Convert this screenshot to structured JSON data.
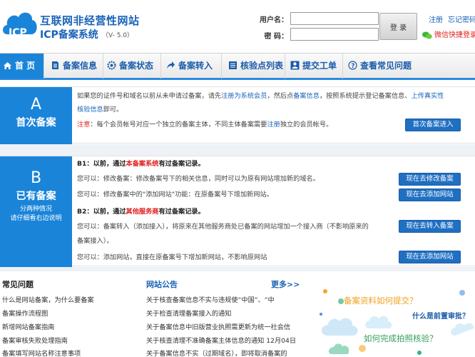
{
  "header": {
    "logo_text": "ICP",
    "title_line1": "互联网非经营性网站",
    "title_line2": "ICP备案系统",
    "version": "（V- 5.0）",
    "username_label": "用户名：",
    "password_label": "密  码：",
    "login_button": "登 录",
    "register_link": "注册",
    "forgot_link": "忘记密码",
    "wechat_text": "微信快捷登录"
  },
  "nav": {
    "items": [
      {
        "label": "首 页",
        "icon": "home-icon"
      },
      {
        "label": "备案信息",
        "icon": "document-icon"
      },
      {
        "label": "备案状态",
        "icon": "gear-icon"
      },
      {
        "label": "备案转入",
        "icon": "arrow-icon"
      },
      {
        "label": "核验点列表",
        "icon": "list-icon"
      },
      {
        "label": "提交工单",
        "icon": "user-icon"
      },
      {
        "label": "查看常见问题",
        "icon": "question-icon"
      }
    ]
  },
  "section_a": {
    "letter": "A",
    "title": "首次备案",
    "line1_a": "如果您的证件号和域名以前从未申请过备案，请先",
    "line1_b": "注册为系统会员",
    "line1_c": "，然后点",
    "line1_d": "备案信息",
    "line1_e": "，按照系统提示登记备案信息、",
    "line1_f": "上传真实性",
    "line2_a": "核验信息",
    "line2_b": "即可。",
    "note_label": "注意",
    "note_a": "：每个会员帐号对应一个独立的备案主体，不同主体备案需要",
    "note_b": "注册",
    "note_c": "独立的会员帐号。",
    "button": "首次备案进入"
  },
  "section_b": {
    "letter": "B",
    "title": "已有备案",
    "sub1": "分两种情况",
    "sub2": "请仔细看右边说明",
    "b1_a": "B1：以前，通过",
    "b1_b": "本备案系统",
    "b1_c": "有过备案记录。",
    "b1_line1": "您可以：修改备案：修改备案号下的相关信息，同时可以为原有网站增加新的域名。",
    "b1_line2": "您可以：修改备案中的\"添加网站\"功能：在原备案号下增加新网站。",
    "b2_a": "B2：以前，通过",
    "b2_b": "其他服务商",
    "b2_c": "有过备案记录。",
    "b2_line1": "您可以：备案转入（添加接入），将原来在其他服务商处已备案的网站增加一个接入商（不影响原来的",
    "b2_line1b": "备案接入）。",
    "b2_line2": "您可以：添加网站，直接在原备案号下增加新网站，不影响原网站",
    "btn_modify": "现在去修改备案",
    "btn_add1": "现在去添加网站",
    "btn_transfer": "现在去转入备案",
    "btn_add2": "现在去添加网站"
  },
  "faq": {
    "title": "常见问题",
    "items": [
      "什么是网站备案，为什么要备案",
      "备案操作流程图",
      "新增网站备案指南",
      "备案审核失败处理指南",
      "备案填写网站名称注意事项"
    ]
  },
  "announcements": {
    "title": "网站公告",
    "more": "更多>>",
    "items": [
      "关于核查备案信息不实与违规使“中国”、“中",
      "关于检查清理备案接入的通知",
      "关于备案信息中旧版营业执照需更新为统一社会信",
      "关于核查清理不准确备案主体信息的通知  12月04日",
      "关于备案信息不实（过期域名），即将取消备案的"
    ]
  },
  "promo": {
    "q1": "备案资料如何提交？",
    "q2": "什么是前置审批？",
    "q3": "如何完成拍照核验？"
  }
}
